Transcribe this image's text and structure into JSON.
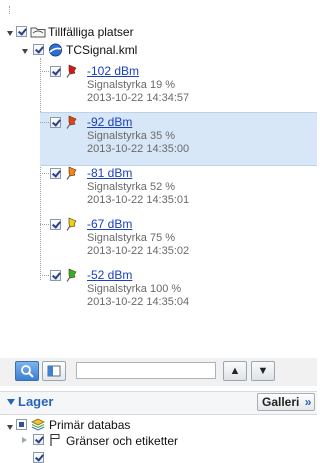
{
  "tree": {
    "root_label": "Tillfälliga platser",
    "file_label": "TCSignal.kml",
    "items": [
      {
        "dbm": "-102 dBm",
        "strength": "Signalstyrka 19 %",
        "time": "2013-10-22 14:34:57",
        "pin_color": "#d8141c"
      },
      {
        "dbm": "-92 dBm",
        "strength": "Signalstyrka 35 %",
        "time": "2013-10-22 14:35:00",
        "pin_color": "#e0451a"
      },
      {
        "dbm": "-81 dBm",
        "strength": "Signalstyrka 52 %",
        "time": "2013-10-22 14:35:01",
        "pin_color": "#f08a14"
      },
      {
        "dbm": "-67 dBm",
        "strength": "Signalstyrka 75 %",
        "time": "2013-10-22 14:35:02",
        "pin_color": "#e8d21a"
      },
      {
        "dbm": "-52 dBm",
        "strength": "Signalstyrka 100 %",
        "time": "2013-10-22 14:35:04",
        "pin_color": "#2db52a"
      }
    ],
    "selected_index": 1
  },
  "toolbar": {
    "search_value": "",
    "up_label": "▲",
    "down_label": "▼"
  },
  "layers": {
    "header_label": "Lager",
    "gallery_label": "Galleri",
    "gallery_chevron": "»",
    "primary_db_label": "Primär databas",
    "borders_label": "Gränser och etiketter"
  },
  "colors": {
    "selection_bg": "#d8e7f7",
    "link": "#1a3fc0",
    "header_text": "#2a62b8"
  },
  "icons": {
    "root": "folder-network-icon",
    "file": "globe-icon",
    "items": "placemark-pin-icon",
    "search_tool": "search-icon",
    "panel_tool": "panel-toggle-icon",
    "primary_db": "layers-stack-icon",
    "borders": "flag-icon"
  }
}
